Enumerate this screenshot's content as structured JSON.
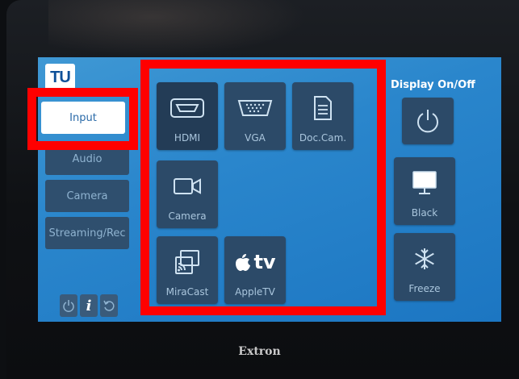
{
  "logo": {
    "text": "TU"
  },
  "sidebar": {
    "items": [
      {
        "label": "Input",
        "selected": true
      },
      {
        "label": "Audio",
        "selected": false
      },
      {
        "label": "Camera",
        "selected": false
      },
      {
        "label": "Streaming/Rec",
        "selected": false
      }
    ]
  },
  "inputs": [
    {
      "label": "HDMI",
      "icon": "hdmi-icon",
      "selected": true
    },
    {
      "label": "VGA",
      "icon": "vga-icon",
      "selected": false
    },
    {
      "label": "Doc.Cam.",
      "icon": "document-camera-icon",
      "selected": false
    },
    {
      "label": "Camera",
      "icon": "video-camera-icon",
      "selected": false
    },
    {
      "label": "MiraCast",
      "icon": "cast-icon",
      "selected": false
    },
    {
      "label": "AppleTV",
      "icon": "apple-tv-icon",
      "selected": false
    }
  ],
  "appletv_logo": {
    "text": "tv"
  },
  "display": {
    "title": "Display On/Off",
    "buttons": [
      {
        "label": "",
        "icon": "power-icon"
      },
      {
        "label": "Black",
        "icon": "monitor-icon"
      },
      {
        "label": "Freeze",
        "icon": "snowflake-icon"
      }
    ]
  },
  "footer_icons": [
    "power-icon",
    "info-icon",
    "refresh-icon"
  ],
  "footer_info_glyph": "i",
  "device_brand": "Extron",
  "colors": {
    "screen": "#2a86cc",
    "tile": "#2c4a68",
    "highlight": "#ff0000"
  }
}
